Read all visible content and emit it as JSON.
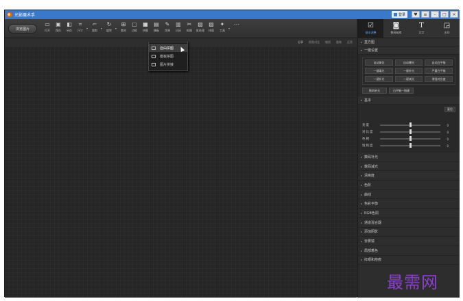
{
  "window": {
    "title": "光影魔术手"
  },
  "titlebar": {
    "login_label": "登录",
    "controls": [
      "♥",
      "≡",
      "–",
      "□",
      "×"
    ]
  },
  "toolbar": {
    "open_button": "浏览图片",
    "tools": [
      {
        "id": "open",
        "glyph": "▭",
        "label": "打开",
        "arrow": false
      },
      {
        "id": "save",
        "glyph": "▣",
        "label": "保存",
        "arrow": false
      },
      {
        "id": "saveas",
        "glyph": "◧",
        "label": "另存",
        "arrow": false
      },
      {
        "id": "size",
        "glyph": "⌗",
        "label": "尺寸",
        "arrow": true
      },
      {
        "id": "crop",
        "glyph": "⌐",
        "label": "裁剪",
        "arrow": true
      },
      {
        "id": "rotate",
        "glyph": "↻",
        "label": "旋转",
        "arrow": true
      },
      {
        "id": "material",
        "glyph": "⊞",
        "label": "素材",
        "arrow": false
      },
      {
        "id": "border",
        "glyph": "▢",
        "label": "边框",
        "arrow": false
      },
      {
        "id": "puzzle",
        "glyph": "▦",
        "label": "拼图",
        "arrow": false
      },
      {
        "id": "template",
        "glyph": "▤",
        "label": "模板",
        "arrow": false
      },
      {
        "id": "doodle",
        "glyph": "✎",
        "label": "涂鸦",
        "arrow": false
      },
      {
        "id": "calendar",
        "glyph": "▥",
        "label": "日历",
        "arrow": false
      },
      {
        "id": "cutout",
        "glyph": "✂",
        "label": "抠图",
        "arrow": false
      },
      {
        "id": "batch",
        "glyph": "▧",
        "label": "批处理",
        "arrow": false
      },
      {
        "id": "typeset",
        "glyph": "▨",
        "label": "排版",
        "arrow": false
      },
      {
        "id": "tools",
        "glyph": "✦",
        "label": "工具",
        "arrow": true
      },
      {
        "id": "more",
        "glyph": "⋯",
        "label": "",
        "arrow": false
      }
    ],
    "active_tool": "puzzle"
  },
  "subbar": {
    "items": [
      {
        "label": "分享",
        "enabled": true
      },
      {
        "label": "原图对比",
        "enabled": false
      },
      {
        "label": "撤销",
        "enabled": false
      },
      {
        "label": "重做",
        "enabled": false
      },
      {
        "label": "还原",
        "enabled": false
      }
    ]
  },
  "dropdown": {
    "items": [
      {
        "label": "自由拼图",
        "highlighted": true
      },
      {
        "label": "模板拼图",
        "highlighted": false
      },
      {
        "label": "图片拼接",
        "highlighted": false
      }
    ]
  },
  "panel": {
    "tabs": [
      {
        "glyph": "☑",
        "label": "基本调整",
        "active": true
      },
      {
        "glyph": "◙",
        "label": "数码暗房",
        "active": false
      },
      {
        "glyph": "T",
        "label": "文字",
        "active": false
      },
      {
        "glyph": "◲",
        "label": "水印",
        "active": false
      }
    ],
    "histogram_label": "直方图",
    "onekey": {
      "title": "一键设置",
      "buttons": [
        "自动美化",
        "自动曝光",
        "自动白平衡",
        "一键填光",
        "一键补光",
        "严重白平衡",
        "一键补光",
        "一键减光",
        "增强对比度"
      ],
      "extra": [
        "数码补光",
        "白平衡一指键"
      ]
    },
    "basic": {
      "title": "基本",
      "reset_label": "复位",
      "sliders": [
        {
          "label": "亮度",
          "value": 0,
          "level": 0.5
        },
        {
          "label": "对比度",
          "value": 0,
          "level": 0.5
        },
        {
          "label": "色相",
          "value": 0,
          "level": 0.5
        },
        {
          "label": "饱和度",
          "value": 0,
          "level": 0.5
        }
      ]
    },
    "sections": [
      "数码补光",
      "数码减光",
      "清晰度",
      "色阶",
      "曲线",
      "色彩平衡",
      "RGB色调",
      "通道混合器",
      "添加阴影",
      "去雾镜",
      "局部着色",
      "红眼和痘痕"
    ]
  },
  "watermark": "最需网"
}
